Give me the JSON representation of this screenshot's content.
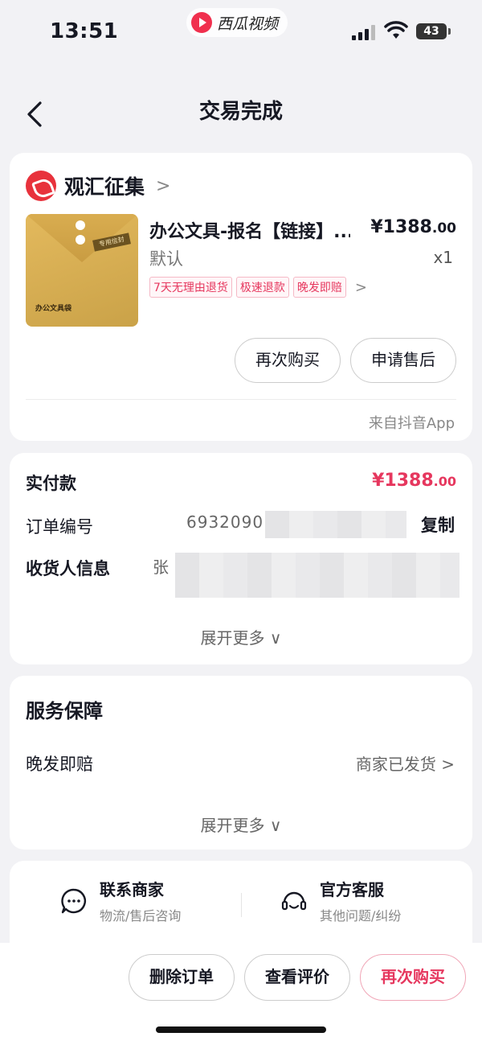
{
  "status_bar": {
    "time": "13:51",
    "app_name": "西瓜视频",
    "battery": "43"
  },
  "nav": {
    "title": "交易完成"
  },
  "shop": {
    "name": "观汇征集"
  },
  "product": {
    "title": "办公文具-报名【链接】...",
    "price": "¥1388",
    "price_decimal": ".00",
    "spec": "默认",
    "quantity": "x1",
    "thumb_label": "办公文具袋",
    "thumb_tag": "专用信封",
    "tags": [
      "7天无理由退货",
      "极速退款",
      "晚发即赔"
    ]
  },
  "actions": {
    "rebuy": "再次购买",
    "after_sale": "申请售后"
  },
  "source": "来自抖音App",
  "order": {
    "paid_label": "实付款",
    "paid_amount": "¥1388",
    "paid_decimal": ".00",
    "order_no_label": "订单编号",
    "order_no": "6932090",
    "copy": "复制",
    "receiver_label": "收货人信息",
    "receiver_name": "张",
    "expand": "展开更多"
  },
  "service": {
    "title": "服务保障",
    "item_label": "晚发即赔",
    "item_status": "商家已发货",
    "expand": "展开更多"
  },
  "contact": {
    "merchant": "联系商家",
    "merchant_sub": "物流/售后咨询",
    "official": "官方客服",
    "official_sub": "其他问题/纠纷"
  },
  "bottom": {
    "delete": "删除订单",
    "view_review": "查看评价",
    "rebuy": "再次购买"
  },
  "colors": {
    "accent": "#e6375e",
    "background": "#f2f2f5"
  }
}
